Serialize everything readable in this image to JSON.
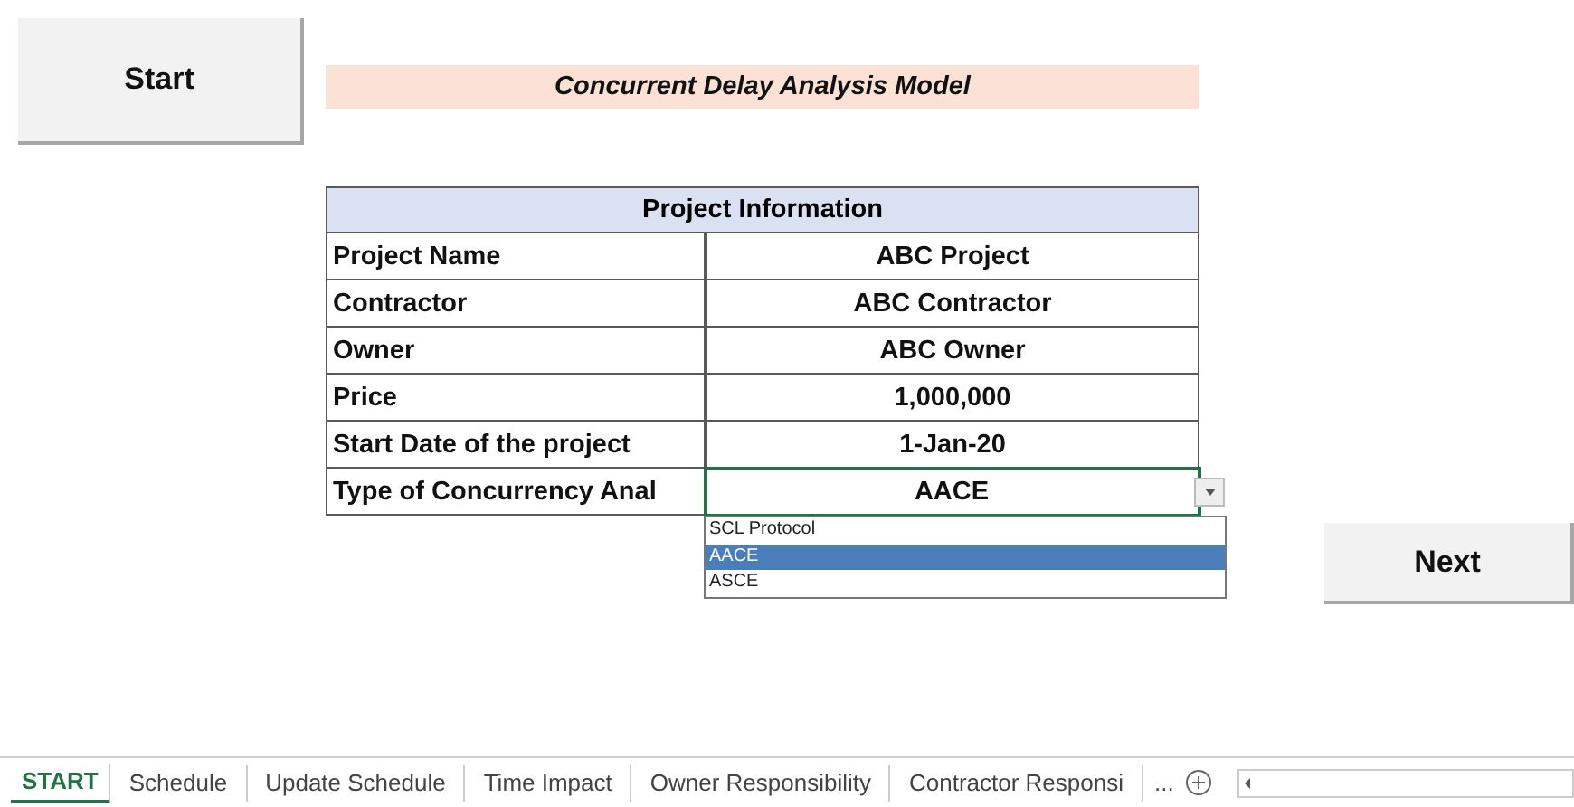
{
  "start_button": {
    "label": "Start"
  },
  "title": "Concurrent Delay Analysis Model",
  "project_table": {
    "header": "Project Information",
    "rows": [
      {
        "label": "Project Name",
        "value": "ABC Project"
      },
      {
        "label": "Contractor",
        "value": "ABC Contractor"
      },
      {
        "label": "Owner",
        "value": "ABC Owner"
      },
      {
        "label": "Price",
        "value": "1,000,000"
      },
      {
        "label": "Start Date of the project",
        "value": "1-Jan-20"
      },
      {
        "label": "Type of Concurrency Anal",
        "value": "AACE",
        "active": true
      }
    ]
  },
  "dropdown": {
    "options": [
      {
        "label": "SCL Protocol",
        "selected": false
      },
      {
        "label": "AACE",
        "selected": true
      },
      {
        "label": "ASCE",
        "selected": false
      }
    ]
  },
  "next_button": {
    "label": "Next"
  },
  "sheet_tabs": [
    {
      "label": "START",
      "selected": true
    },
    {
      "label": "Schedule",
      "selected": false
    },
    {
      "label": "Update Schedule",
      "selected": false
    },
    {
      "label": "Time Impact",
      "selected": false
    },
    {
      "label": "Owner Responsibility",
      "selected": false
    },
    {
      "label": "Contractor Responsi",
      "selected": false
    }
  ],
  "more_tabs": "..."
}
